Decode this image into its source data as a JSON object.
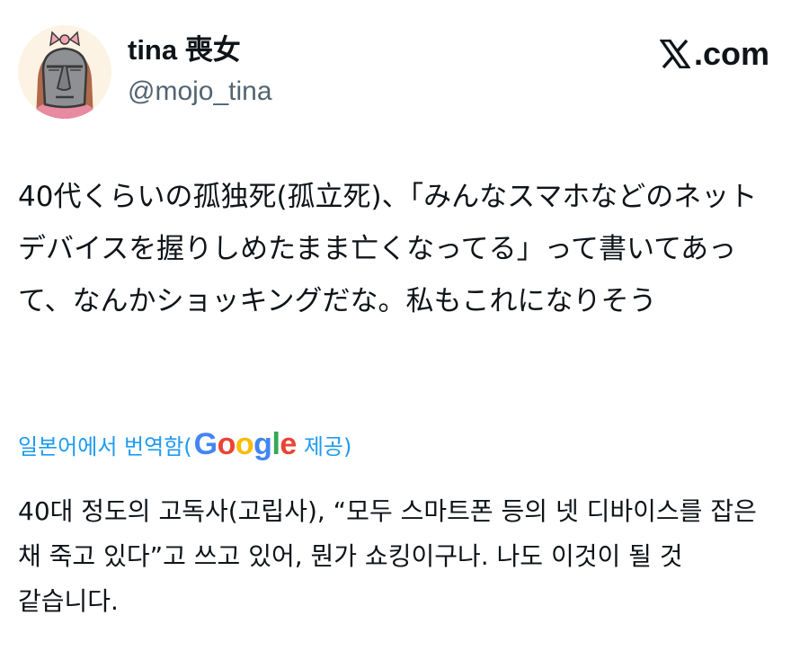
{
  "author": {
    "display_name": "tina 喪女",
    "handle": "@mojo_tina"
  },
  "brand": {
    "text": ".com"
  },
  "tweet": {
    "text": "40代くらいの孤独死(孤立死)、「みんなスマホなどのネットデバイスを握りしめたまま亡くなってる」って書いてあって、なんかショッキングだな。私もこれになりそう"
  },
  "translation": {
    "prefix": "일본어에서 번역함(",
    "google": [
      "G",
      "o",
      "o",
      "g",
      "l",
      "e"
    ],
    "suffix": "제공)",
    "text": "40대 정도의 고독사(고립사), “모두 스마트폰 등의 넷 디바이스를 잡은 채 죽고 있다”고 쓰고 있어, 뭔가 쇼킹이구나. 나도 이것이 될 것 같습니다."
  },
  "colors": {
    "link_blue": "#1d9bf0",
    "handle_gray": "#536471",
    "text": "#0f1419"
  },
  "icons": {
    "avatar": "moai-girl-avatar-icon",
    "brand": "x-logo-icon"
  }
}
